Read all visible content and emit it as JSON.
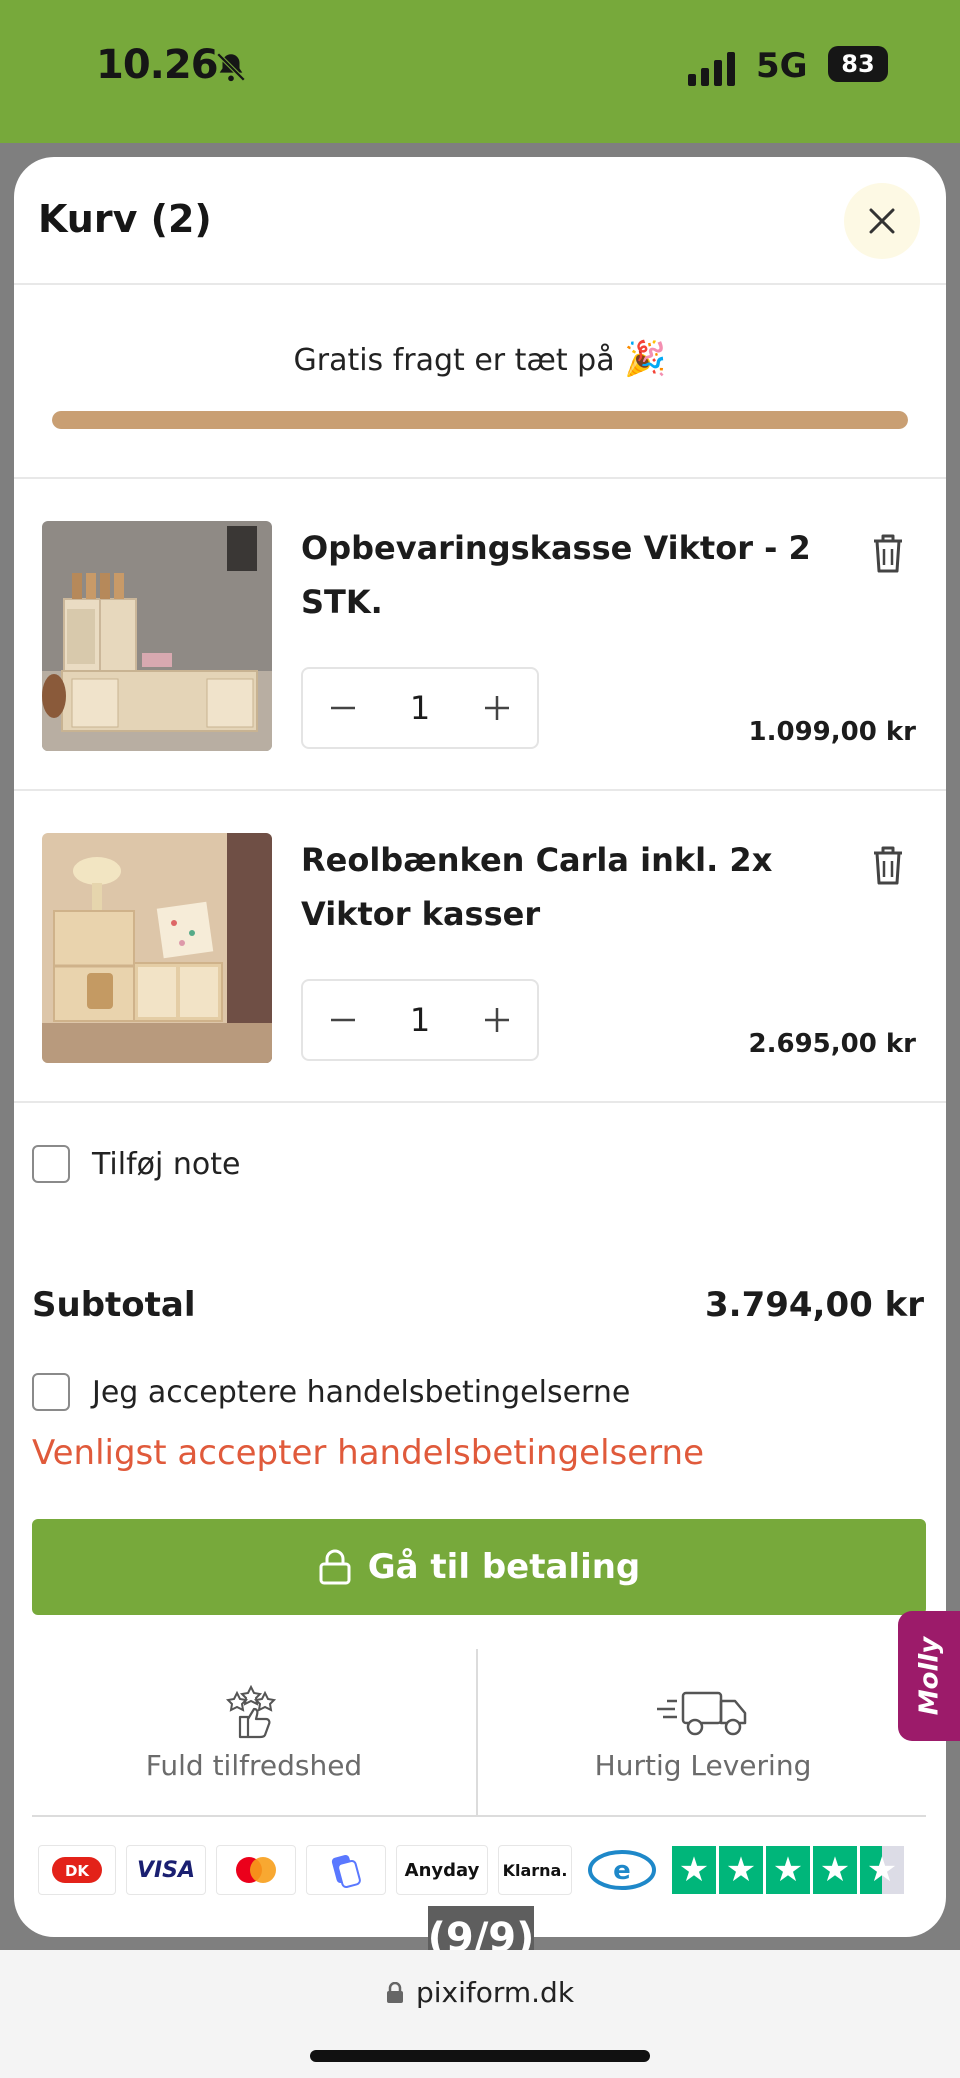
{
  "status_bar": {
    "time": "10.26",
    "network": "5G",
    "battery": "83"
  },
  "cart": {
    "title": "Kurv (2)",
    "free_shipping_text": "Gratis fragt er tæt på",
    "free_shipping_emoji": "🎉",
    "free_shipping_progress": 1.0,
    "items": [
      {
        "name": "Opbevaringskasse Viktor - 2 STK.",
        "quantity": "1",
        "price": "1.099,00 kr"
      },
      {
        "name": "Reolbænken Carla inkl. 2x Viktor kasser",
        "quantity": "1",
        "price": "2.695,00 kr"
      }
    ],
    "note_label": "Tilføj note",
    "subtotal_label": "Subtotal",
    "subtotal_value": "3.794,00 kr",
    "terms_label": "Jeg acceptere handelsbetingelserne",
    "terms_error": "Venligst accepter handelsbetingelserne",
    "checkout_label": "Gå til betaling",
    "features": [
      {
        "label": "Fuld tilfredshed",
        "icon": "thumbs-up-stars-icon"
      },
      {
        "label": "Hurtig Levering",
        "icon": "delivery-truck-icon"
      }
    ],
    "payment_methods": [
      "Dankort",
      "VISA",
      "Mastercard",
      "MobilePay",
      "Anyday",
      "Klarna.",
      "eDankort",
      "Trustpilot"
    ],
    "trustpilot_stars": 4.5
  },
  "chat_widget": {
    "label": "Molly"
  },
  "page_indicator": "(9/9)",
  "browser": {
    "url": "pixiform.dk"
  },
  "colors": {
    "brand_green": "#77a93b",
    "progress": "#c99f73",
    "error": "#e05a3b",
    "molly": "#9c1b6a",
    "trustpilot": "#00b67a"
  }
}
